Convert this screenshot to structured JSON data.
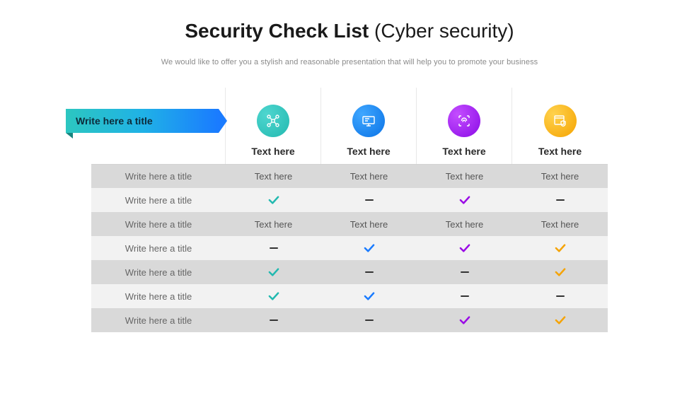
{
  "title": {
    "bold": "Security Check List",
    "light": " (Cyber security)"
  },
  "subtitle": "We would like to offer you a stylish and reasonable presentation that will help you to promote your business",
  "ribbon_label": "Write here a title",
  "columns": [
    {
      "icon": "network-icon",
      "color": "teal",
      "label": "Text here"
    },
    {
      "icon": "monitor-icon",
      "color": "blue",
      "label": "Text here"
    },
    {
      "icon": "fingerprint-icon",
      "color": "purple",
      "label": "Text here"
    },
    {
      "icon": "browser-shield-icon",
      "color": "yellow",
      "label": "Text here"
    }
  ],
  "rows": [
    {
      "label": "Write here a title",
      "cells": [
        "Text here",
        "Text here",
        "Text here",
        "Text here"
      ]
    },
    {
      "label": "Write here a title",
      "cells": [
        "check",
        "dash",
        "check",
        "dash"
      ]
    },
    {
      "label": "Write here a title",
      "cells": [
        "Text here",
        "Text here",
        "Text here",
        "Text here"
      ]
    },
    {
      "label": "Write here a title",
      "cells": [
        "dash",
        "check",
        "check",
        "check"
      ]
    },
    {
      "label": "Write here a title",
      "cells": [
        "check",
        "dash",
        "dash",
        "check"
      ]
    },
    {
      "label": "Write here a title",
      "cells": [
        "check",
        "check",
        "dash",
        "dash"
      ]
    },
    {
      "label": "Write here a title",
      "cells": [
        "dash",
        "dash",
        "check",
        "check"
      ]
    }
  ],
  "col_colors": [
    "teal",
    "blue",
    "purple",
    "yellow"
  ]
}
